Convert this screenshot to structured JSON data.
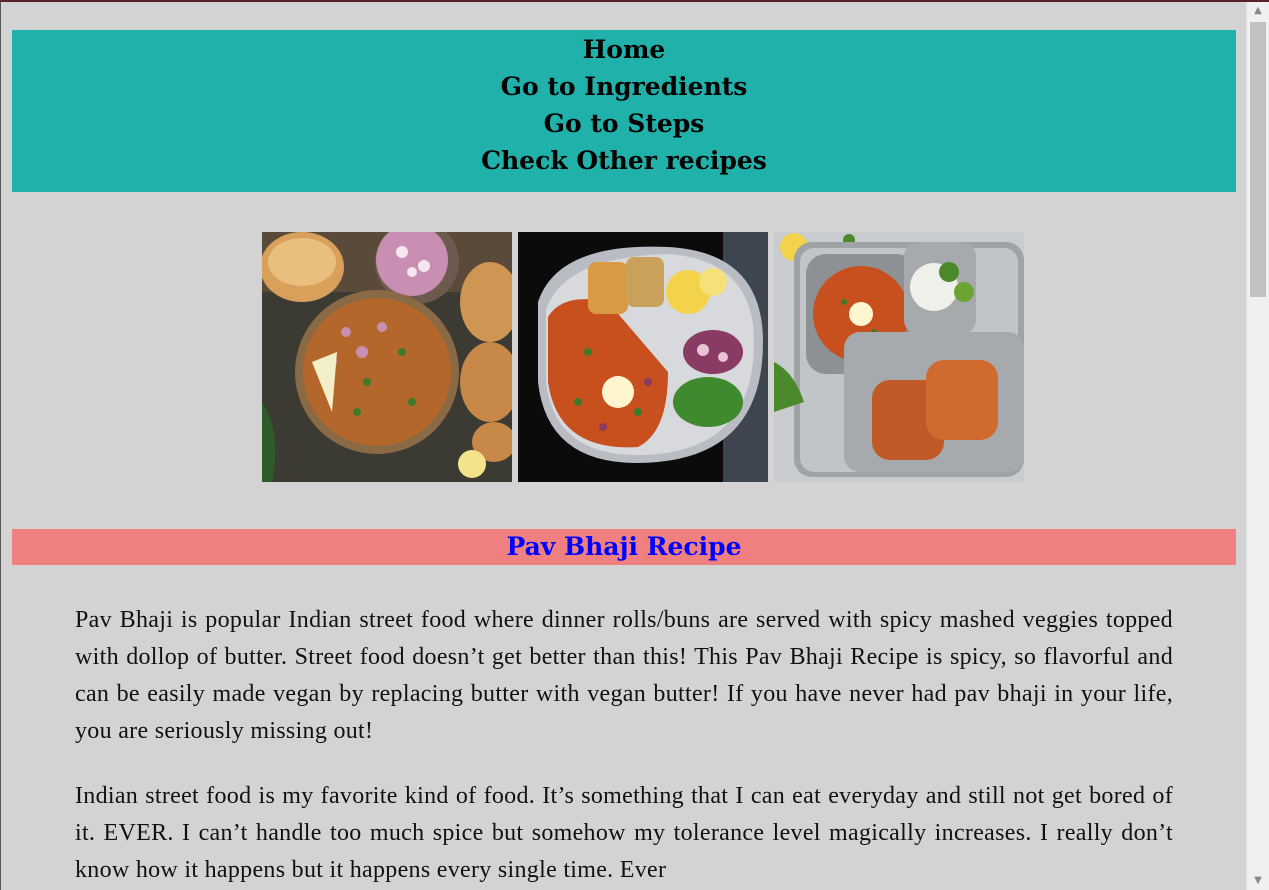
{
  "nav": {
    "items": [
      {
        "label": "Home"
      },
      {
        "label": "Go to Ingredients"
      },
      {
        "label": "Go to Steps"
      },
      {
        "label": "Check Other recipes"
      }
    ]
  },
  "gallery": {
    "images": [
      {
        "icon": "pav-bhaji-bowl-photo"
      },
      {
        "icon": "pav-bhaji-plate-photo"
      },
      {
        "icon": "pav-bhaji-thali-photo"
      }
    ]
  },
  "recipe": {
    "title": "Pav Bhaji Recipe",
    "paragraphs": [
      "Pav Bhaji is popular Indian street food where dinner rolls/buns are served with spicy mashed veggies topped with dollop of butter. Street food doesn’t get better than this! This Pav Bhaji Recipe is spicy, so flavorful and can be easily made vegan by replacing butter with vegan butter! If you have never had pav bhaji in your life, you are seriously missing out!",
      "Indian street food is my favorite kind of food. It’s something that I can eat everyday and still not get bored of it. EVER. I can’t handle too much spice but somehow my tolerance level magically increases. I really don’t know how it happens but it happens every single time. Ever"
    ]
  },
  "colors": {
    "nav_bg": "#20b2aa",
    "title_bg": "#f08080",
    "title_text": "#0000ff",
    "page_bg": "#d3d3d3"
  },
  "scrollbar": {
    "up_icon": "▲",
    "down_icon": "▼"
  }
}
